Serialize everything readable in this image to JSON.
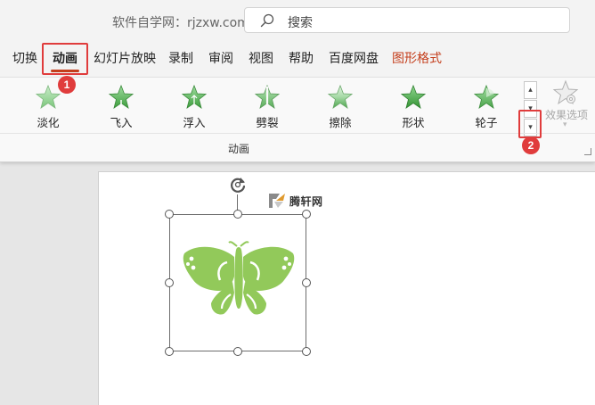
{
  "header": {
    "site_label": "软件自学网：rjzxw.com",
    "search_placeholder": "搜索"
  },
  "tabs": [
    {
      "label": "切换",
      "active": false
    },
    {
      "label": "动画",
      "active": true
    },
    {
      "label": "幻灯片放映",
      "active": false
    },
    {
      "label": "录制",
      "active": false
    },
    {
      "label": "审阅",
      "active": false
    },
    {
      "label": "视图",
      "active": false
    },
    {
      "label": "帮助",
      "active": false
    },
    {
      "label": "百度网盘",
      "active": false
    },
    {
      "label": "图形格式",
      "active": false,
      "contextual": true
    }
  ],
  "ribbon": {
    "animations": [
      {
        "label": "淡化",
        "icon": "fade-star-icon"
      },
      {
        "label": "飞入",
        "icon": "fly-in-star-icon"
      },
      {
        "label": "浮入",
        "icon": "float-in-star-icon"
      },
      {
        "label": "劈裂",
        "icon": "split-star-icon"
      },
      {
        "label": "擦除",
        "icon": "wipe-star-icon"
      },
      {
        "label": "形状",
        "icon": "shape-star-icon"
      },
      {
        "label": "轮子",
        "icon": "wheel-star-icon"
      }
    ],
    "group_label": "动画",
    "scroll_up": "▴",
    "scroll_down": "▾",
    "more_button": "▾",
    "effect_options_label": "效果选项",
    "effect_options_disabled": true
  },
  "slide": {
    "watermark_text": "腾轩网",
    "shape": "butterfly-icon",
    "shape_color": "#92c95a"
  },
  "annotations": [
    {
      "number": "1",
      "color": "#e03c3c"
    },
    {
      "number": "2",
      "color": "#e03c3c"
    }
  ],
  "colors": {
    "accent": "#c43e1c",
    "star_green": "#5ab45a",
    "highlight_red": "#e03c3c"
  }
}
